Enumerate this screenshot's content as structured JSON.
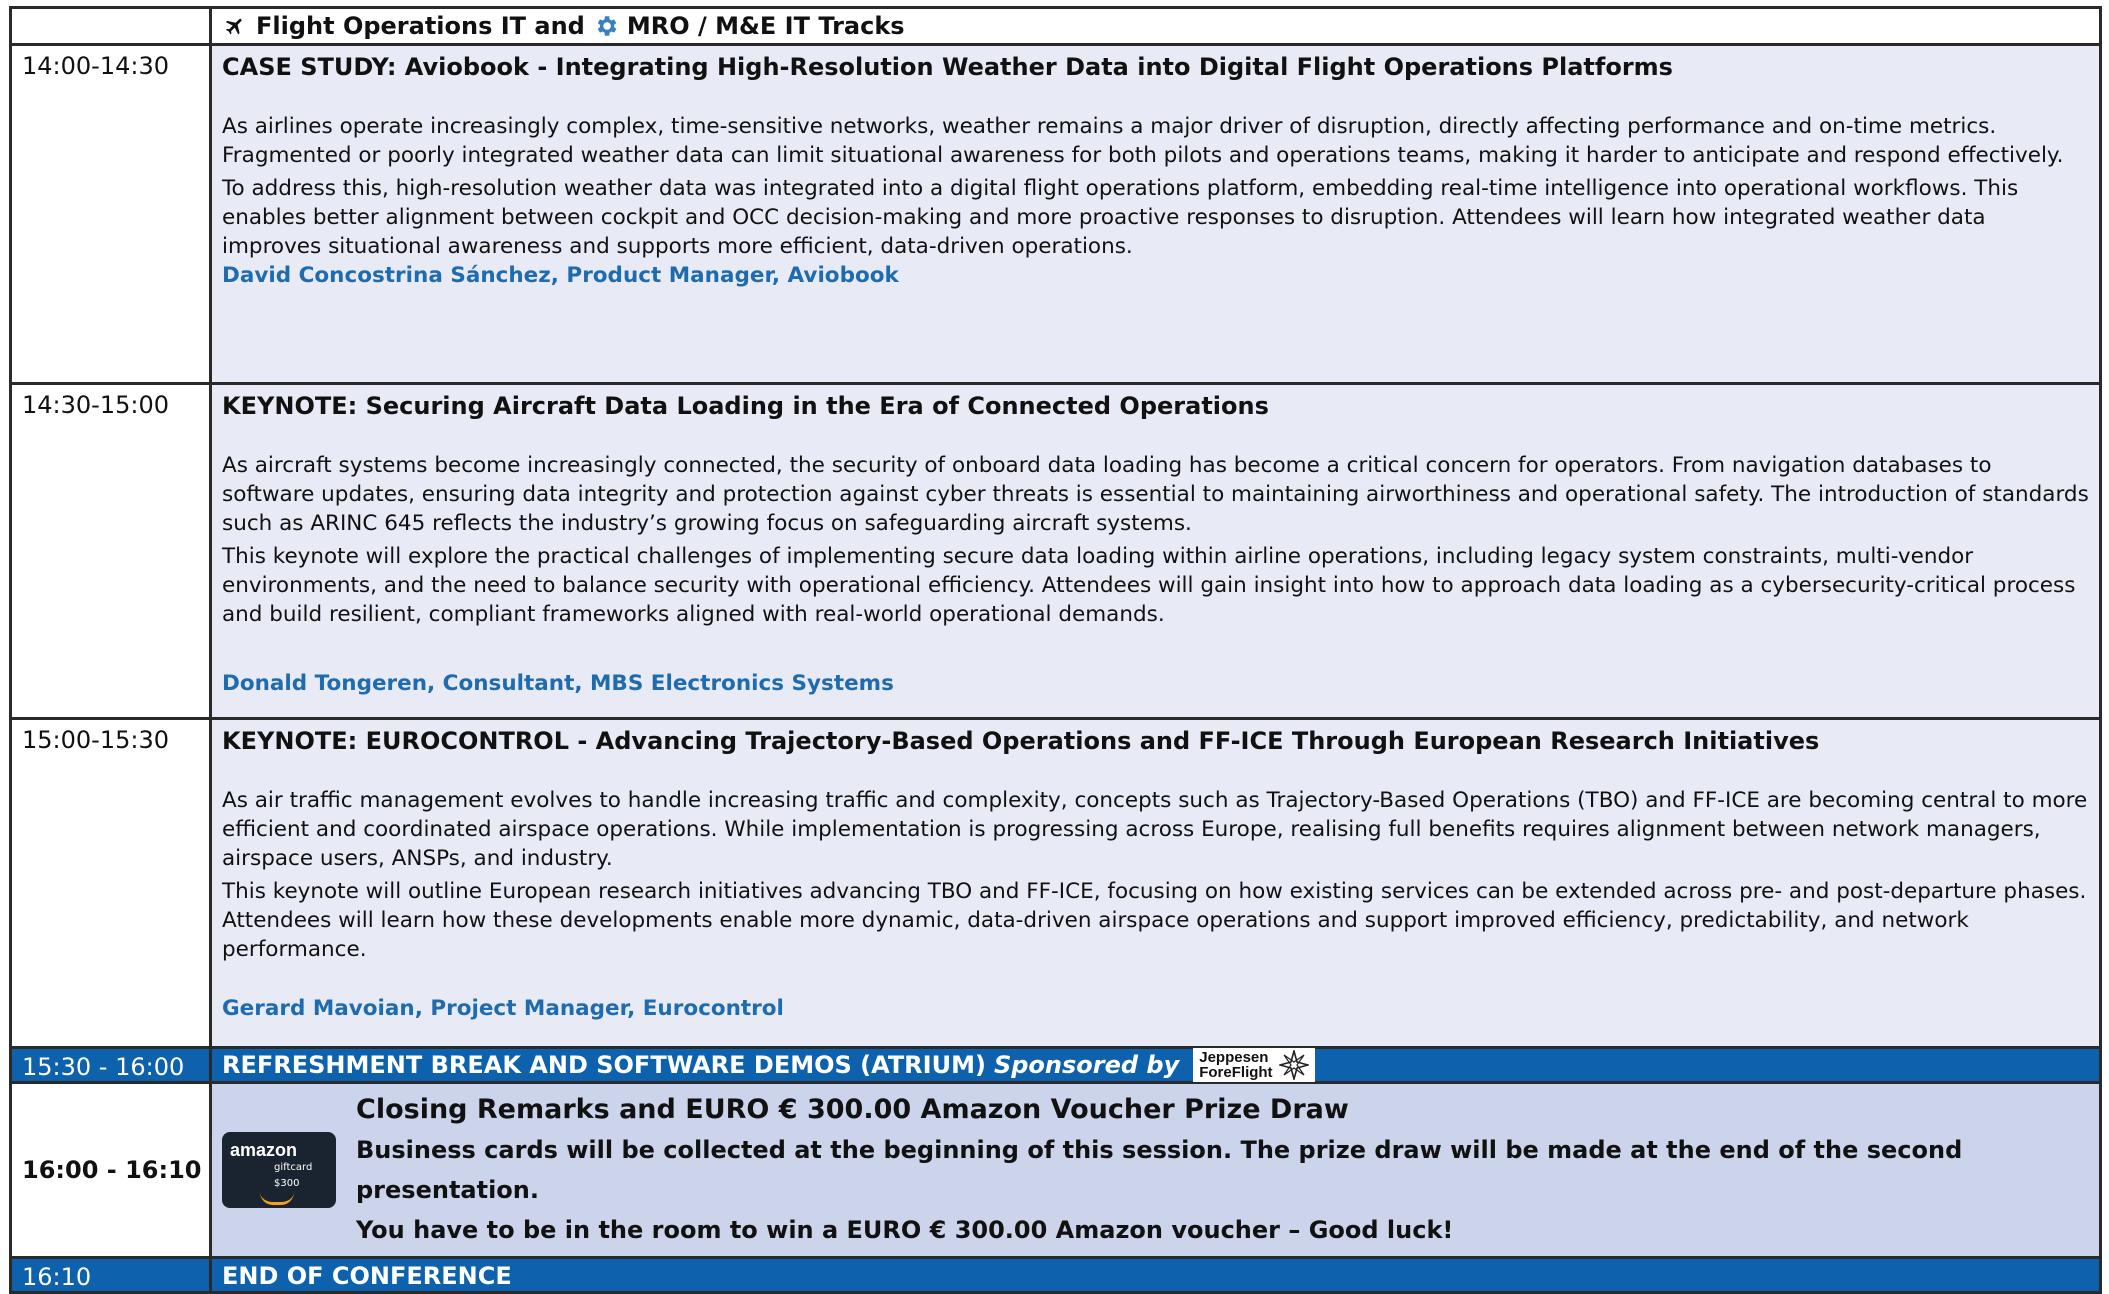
{
  "header": {
    "title_part1": "Flight Operations IT and",
    "title_part2": "MRO / M&E IT Tracks",
    "icons": [
      "airplane-icon",
      "gear-icon"
    ]
  },
  "sessions": [
    {
      "time": "14:00-14:30",
      "title": "CASE STUDY: Aviobook - Integrating High-Resolution Weather Data into Digital Flight Operations Platforms",
      "paragraphs": [
        "As airlines operate increasingly complex, time-sensitive networks, weather remains a major driver of disruption, directly affecting performance and on-time metrics. Fragmented or poorly integrated weather data can limit situational awareness for both pilots and operations teams, making it harder to anticipate and respond effectively.",
        "To address this, high-resolution weather data was integrated into a digital flight operations platform, embedding real-time intelligence into operational workflows. This enables better alignment between cockpit and OCC decision-making and more proactive responses to disruption. Attendees will learn how integrated weather data improves situational awareness and supports more efficient, data-driven operations."
      ],
      "speaker": "David Concostrina Sánchez, Product Manager, Aviobook"
    },
    {
      "time": "14:30-15:00",
      "title": "KEYNOTE: Securing Aircraft Data Loading in the Era of Connected Operations",
      "paragraphs": [
        "As aircraft systems become increasingly connected, the security of onboard data loading has become a critical concern for operators. From navigation databases to software updates, ensuring data integrity and protection against cyber threats is essential to maintaining airworthiness and operational safety. The introduction of standards such as ARINC 645 reflects the industry’s growing focus on safeguarding aircraft systems.",
        "This keynote will explore the practical challenges of implementing secure data loading within airline operations, including legacy system constraints, multi-vendor environments, and the need to balance security with operational efficiency. Attendees will gain insight into how to approach data loading as a cybersecurity-critical process and build resilient, compliant frameworks aligned with real-world operational demands."
      ],
      "speaker": "Donald Tongeren, Consultant, MBS Electronics Systems"
    },
    {
      "time": "15:00-15:30",
      "title": "KEYNOTE: EUROCONTROL -  Advancing Trajectory-Based Operations and FF-ICE Through European Research Initiatives",
      "paragraphs": [
        "As air traffic management evolves to handle increasing traffic and complexity, concepts such as Trajectory-Based Operations (TBO) and FF-ICE are becoming central to more efficient and coordinated airspace operations. While implementation is progressing across Europe, realising full benefits requires alignment between network managers, airspace users, ANSPs, and industry.",
        "This keynote will outline European research initiatives advancing TBO and FF-ICE, focusing on how existing services can be extended across pre- and post-departure phases. Attendees will learn how these developments enable more dynamic, data-driven airspace operations and support improved efficiency, predictability, and network performance."
      ],
      "speaker": "Gerard Mavoian, Project Manager, Eurocontrol"
    }
  ],
  "break": {
    "time": "15:30 - 16:00",
    "title": "REFRESHMENT BREAK AND SOFTWARE DEMOS (ATRIUM)",
    "sponsored_by": "Sponsored by",
    "sponsor_logo_line1": "Jeppesen",
    "sponsor_logo_line2": "ForeFlight"
  },
  "closing": {
    "time": "16:00 - 16:10",
    "giftcard_brand": "amazon",
    "giftcard_label": "giftcard",
    "giftcard_amount": "$300",
    "title": "Closing Remarks and EURO € 300.00 Amazon Voucher Prize Draw",
    "line2": "Business cards will be collected at the beginning of this session. The prize draw will be made at the end of the second presentation.",
    "line3": "You have to be in the room to win a EURO € 300.00 Amazon voucher – Good luck!"
  },
  "end": {
    "time": "16:10",
    "title": "END OF CONFERENCE"
  },
  "colors": {
    "session_bg": "#e8ebf5",
    "speaker": "#1f6bb0",
    "band_blue": "#0d61ad",
    "closing_bg": "#cbd4eb"
  }
}
